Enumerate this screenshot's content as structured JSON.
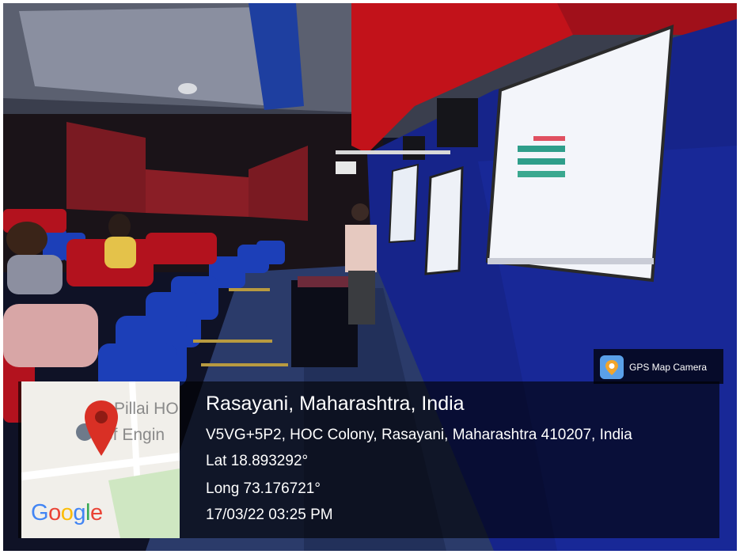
{
  "badge": {
    "label": "GPS Map Camera",
    "icon": "gps-map-camera-icon"
  },
  "map": {
    "label_line1": "Pillai HO",
    "label_line2": "of Engin",
    "logo_text": {
      "g1": "G",
      "o1": "o",
      "o2": "o",
      "g2": "g",
      "l": "l",
      "e": "e"
    },
    "pin_color": "#d93025"
  },
  "location": {
    "title": "Rasayani, Maharashtra, India",
    "address": "V5VG+5P2, HOC Colony, Rasayani, Maharashtra 410207, India",
    "lat": "Lat 18.893292°",
    "long": "Long 73.176721°",
    "datetime": "17/03/22 03:25 PM"
  }
}
